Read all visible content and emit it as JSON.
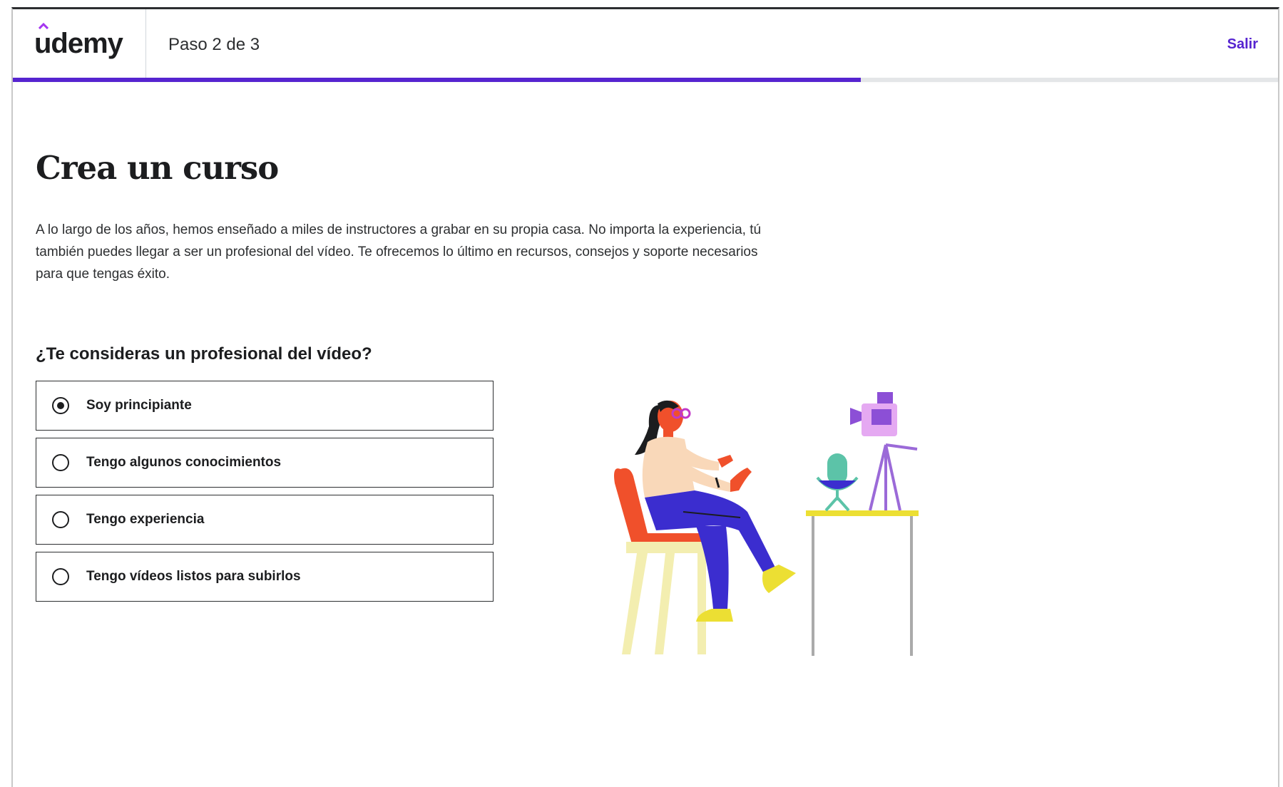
{
  "header": {
    "logo": "udemy",
    "step": "Paso 2 de 3",
    "exit_label": "Salir",
    "progress_percent": 67
  },
  "main": {
    "title": "Crea un curso",
    "intro": "A lo largo de los años, hemos enseñado a miles de instructores a grabar en su propia casa. No importa la experiencia, tú también puedes llegar a ser un profesional del vídeo. Te ofrecemos lo último en recursos, consejos y soporte necesarios para que tengas éxito.",
    "question": "¿Te consideras un profesional del vídeo?",
    "options": [
      {
        "label": "Soy principiante",
        "selected": true
      },
      {
        "label": "Tengo algunos conocimientos",
        "selected": false
      },
      {
        "label": "Tengo experiencia",
        "selected": false
      },
      {
        "label": "Tengo vídeos listos para subirlos",
        "selected": false
      }
    ]
  },
  "colors": {
    "accent": "#5624d0",
    "text": "#1c1d1f"
  }
}
